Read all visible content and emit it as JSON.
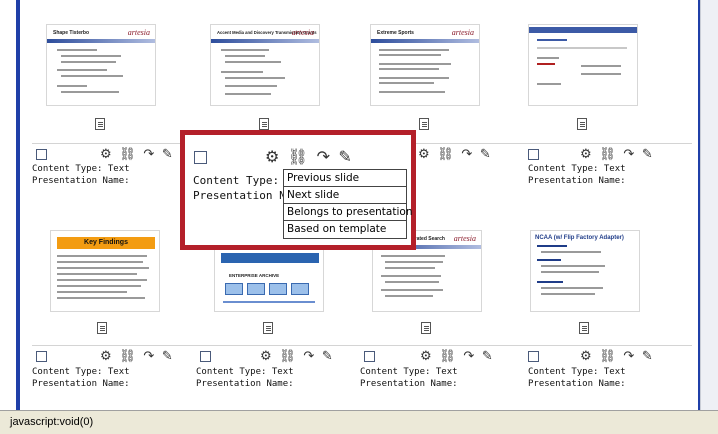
{
  "icons": {
    "checkbox": "checkbox",
    "actions": [
      "gear-icon",
      "link-icon",
      "arrow-icon",
      "edit-icon"
    ],
    "doc": "document-icon"
  },
  "labels": {
    "content_type_label": "Content Type:",
    "presentation_name_label": "Presentation Name:"
  },
  "cards_row1": [
    {
      "slide_title": "Shape Tisterbo",
      "logo": "artesia",
      "content_type": "Text",
      "presentation_name": ""
    },
    {
      "slide_title": "Accent Media and Discovery Transmission Grants",
      "logo": "artesia",
      "content_type": "Text",
      "presentation_name": ""
    },
    {
      "slide_title": "Extreme Sports",
      "logo": "artesia",
      "content_type": "Text",
      "presentation_name": ""
    },
    {
      "slide_title": "",
      "logo": "",
      "content_type": "Text",
      "presentation_name": ""
    }
  ],
  "cards_row2": [
    {
      "slide_title": "Key Findings",
      "logo": "",
      "content_type": "Text",
      "presentation_name": ""
    },
    {
      "slide_title": "ENTERPRISE ARCHIVE",
      "logo": "",
      "content_type": "Text",
      "presentation_name": ""
    },
    {
      "slide_title": "Federated Search",
      "logo": "artesia",
      "content_type": "Text",
      "presentation_name": ""
    },
    {
      "slide_title": "NCAA (w/ Flip Factory Adapter)",
      "logo": "",
      "content_type": "Text",
      "presentation_name": ""
    }
  ],
  "popup": {
    "content_type": "Content Type: Text",
    "presentation_name": "Presentation Name",
    "menu": [
      "Previous slide",
      "Next slide",
      "Belongs to presentation",
      "Based on template"
    ]
  },
  "status_text": "javascript:void(0)"
}
